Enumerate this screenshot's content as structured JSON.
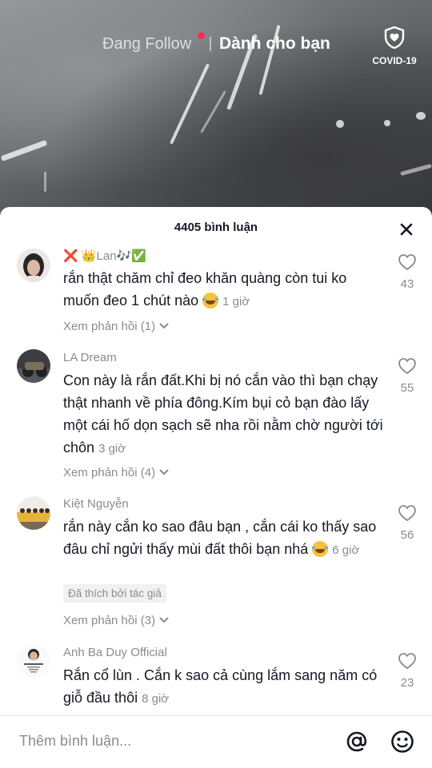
{
  "nav": {
    "following": "Đang Follow",
    "for_you": "Dành cho bạn",
    "covid_label": "COVID-19"
  },
  "sheet": {
    "comment_count": "4405 bình luận"
  },
  "comments": [
    {
      "username": "❌ 👑Lan🎶✅",
      "text": "rắn thật chăm chỉ đeo khăn quàng còn tui ko muốn đeo 1 chút nào",
      "time": "1 giờ",
      "likes": "43",
      "replies": "Xem phản hồi (1)"
    },
    {
      "username": "LA Dream",
      "text": "Con này là rắn đất.Khi bị nó cắn vào thì bạn chạy thật nhanh về phía đông.Kím bụi cỏ bạn đào lấy một cái hố dọn sạch sẽ nha rồi nằm chờ người tới chôn",
      "time": "3 giờ",
      "likes": "55",
      "replies": "Xem phản hồi (4)"
    },
    {
      "username": "Kiệt Nguyễn",
      "text": "rắn này cắn ko sao đâu bạn , cắn cái ko thấy sao đâu chỉ ngửi thấy mùi đất thôi bạn nhá",
      "time": "6 giờ",
      "likes": "56",
      "badge": "Đã thích bởi tác giả",
      "replies": "Xem phản hồi (3)"
    },
    {
      "username": "Anh Ba Duy Official",
      "text": "Rắn cổ lùn . Cắn k sao cả cùng lắm sang năm có giỗ đầu thôi",
      "time": "8 giờ",
      "likes": "23"
    }
  ],
  "input": {
    "placeholder": "Thêm bình luận..."
  },
  "icons": {
    "close": "close-icon",
    "heart": "heart-outline-icon",
    "mention": "at-icon",
    "emoji": "emoji-icon",
    "covid": "shield-heart-icon",
    "chevron": "chevron-down-icon"
  },
  "colors": {
    "live_dot": "#fe2c55",
    "text_primary": "#161823",
    "text_secondary": "#8a8b91"
  }
}
